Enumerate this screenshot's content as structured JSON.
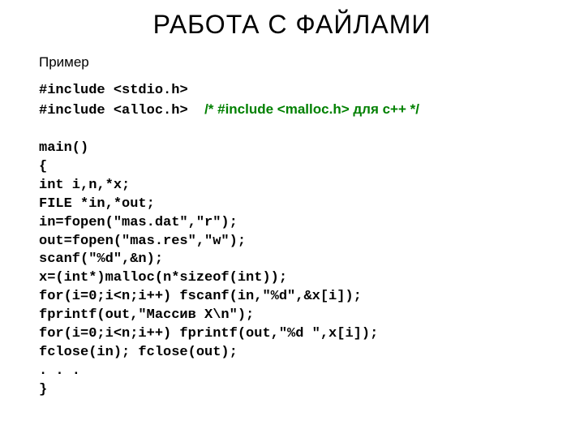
{
  "title": "РАБОТА  С  ФАЙЛАМИ",
  "example_label": "Пример",
  "inc1_a": "#include ",
  "inc1_b": "<stdio.h>",
  "inc2_a": "#include ",
  "inc2_b": "<alloc.h>",
  "inc2_sep": "  ",
  "comment": "/* #include <malloc.h> для c++ */",
  "blank": "",
  "l_main": "main()",
  "l_brace_open": "{",
  "l_decl": "int i,n,*x;",
  "l_file": "FILE *in,*out;",
  "l_in": "in=fopen(\"mas.dat\",\"r\");",
  "l_out": "out=fopen(\"mas.res\",\"w\");",
  "l_scanf": "scanf(\"%d\",&n);",
  "l_malloc": "x=(int*)malloc(n*sizeof(int));",
  "l_for1": "for(i=0;i<n;i++) fscanf(in,\"%d\",&x[i]);",
  "l_fprintf": "fprintf(out,\"Массив X\\n\");",
  "l_for2": "for(i=0;i<n;i++) fprintf(out,\"%d \",x[i]);",
  "l_close": "fclose(in); fclose(out);",
  "l_dots": ". . .",
  "l_brace_close": "}"
}
